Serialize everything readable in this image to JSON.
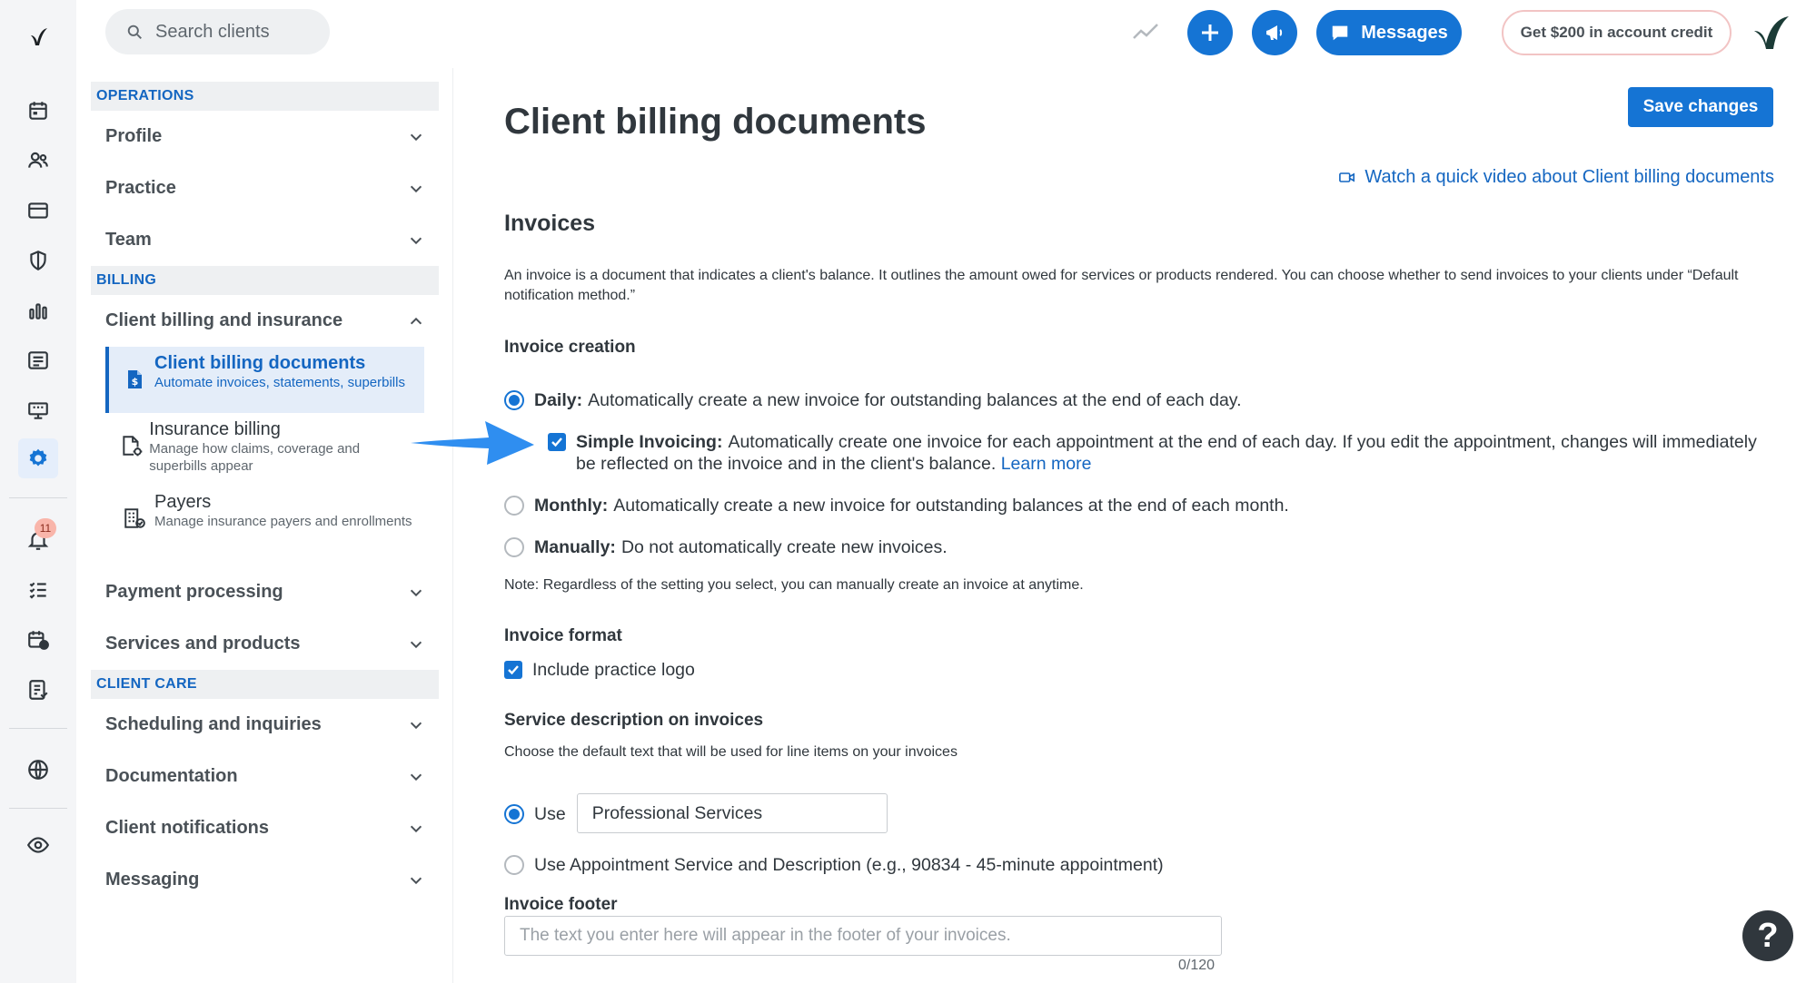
{
  "topbar": {
    "search_placeholder": "Search clients",
    "messages_label": "Messages",
    "credit_label": "Get $200 in account credit"
  },
  "rail": {
    "notification_count": "11",
    "active_item": "settings-icon"
  },
  "nav": {
    "operations_header": "OPERATIONS",
    "operations": [
      "Profile",
      "Practice",
      "Team"
    ],
    "billing_header": "BILLING",
    "billing_group": "Client billing and insurance",
    "billing_sub": [
      {
        "title": "Client billing documents",
        "desc": "Automate invoices, statements, superbills",
        "icon": "document-dollar-icon",
        "active": true
      },
      {
        "title": "Insurance billing",
        "desc": "Manage how claims, coverage and superbills appear",
        "icon": "document-settings-icon",
        "active": false
      },
      {
        "title": "Payers",
        "desc": "Manage insurance payers and enrollments",
        "icon": "building-icon",
        "active": false
      }
    ],
    "billing_more": [
      "Payment processing",
      "Services and products"
    ],
    "client_care_header": "CLIENT CARE",
    "client_care": [
      "Scheduling and inquiries",
      "Documentation",
      "Client notifications",
      "Messaging"
    ]
  },
  "main": {
    "title": "Client billing documents",
    "save_label": "Save changes",
    "video_link": "Watch a quick video about Client billing documents",
    "invoices_heading": "Invoices",
    "invoices_description": "An invoice is a document that indicates a client's balance. It outlines the amount owed for services or products rendered. You can choose whether to send invoices to your clients under “Default notification method.”",
    "invoice_creation_label": "Invoice creation",
    "options": {
      "daily_bold": "Daily:",
      "daily_text": "Automatically create a new invoice for outstanding balances at the end of each day.",
      "simple_bold": "Simple Invoicing:",
      "simple_text": "Automatically create one invoice for each appointment at the end of each day. If you edit the appointment, changes will immediately be reflected on the invoice and in the client's balance.",
      "simple_link": "Learn more",
      "monthly_bold": "Monthly:",
      "monthly_text": "Automatically create a new invoice for outstanding balances at the end of each month.",
      "manually_bold": "Manually:",
      "manually_text": "Do not automatically create new invoices."
    },
    "selected_creation": "daily",
    "simple_invoicing_checked": true,
    "note": "Note: Regardless of the setting you select, you can manually create an invoice at anytime.",
    "invoice_format_label": "Invoice format",
    "include_logo_label": "Include practice logo",
    "include_logo_checked": true,
    "service_desc_label": "Service description on invoices",
    "service_desc_help": "Choose the default text that will be used for line items on your invoices",
    "use_label": "Use",
    "use_value": "Professional Services",
    "use_appointment_label": "Use Appointment Service and Description (e.g., 90834 - 45-minute appointment)",
    "footer_label": "Invoice footer",
    "footer_placeholder": "The text you enter here will appear in the footer of your invoices.",
    "footer_count": "0/120"
  },
  "colors": {
    "primary": "#1574d4",
    "link": "#1466c1",
    "rail_bg": "#f4f5f7",
    "section_bg": "#eef0f2",
    "arrow": "#2f8ef0"
  }
}
